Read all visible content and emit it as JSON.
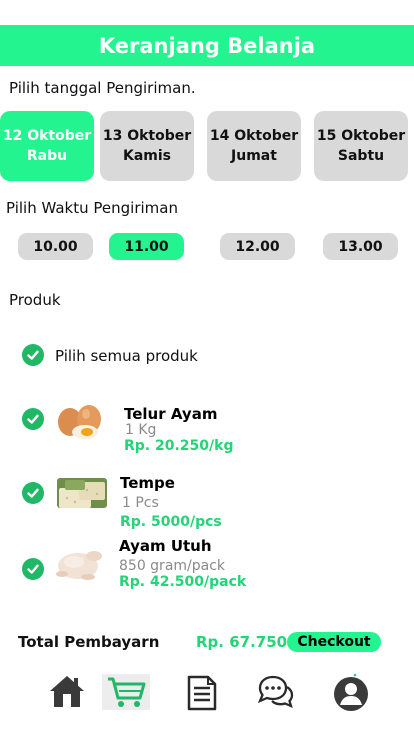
{
  "header": {
    "title": "Keranjang Belanja"
  },
  "delivery_date": {
    "label": "Pilih tanggal Pengiriman.",
    "options": [
      {
        "date": "12 Oktober",
        "day": "Rabu",
        "selected": true
      },
      {
        "date": "13 Oktober",
        "day": "Kamis",
        "selected": false
      },
      {
        "date": "14 Oktober",
        "day": "Jumat",
        "selected": false
      },
      {
        "date": "15 Oktober",
        "day": "Sabtu",
        "selected": false
      }
    ]
  },
  "delivery_time": {
    "label": "Pilih Waktu Pengiriman",
    "options": [
      "10.00",
      "11.00",
      "12.00",
      "13.00"
    ],
    "selected": "11.00"
  },
  "products": {
    "label": "Produk",
    "select_all_label": "Pilih semua produk",
    "items": [
      {
        "name": "Telur Ayam",
        "qty": "1 Kg",
        "price": "Rp. 20.250/kg",
        "icon": "eggs-icon"
      },
      {
        "name": "Tempe",
        "qty": "1 Pcs",
        "price": "Rp. 5000/pcs",
        "icon": "tempe-icon"
      },
      {
        "name": "Ayam Utuh",
        "qty": "850 gram/pack",
        "price": "Rp. 42.500/pack",
        "icon": "chicken-icon"
      }
    ]
  },
  "footer": {
    "total_label": "Total Pembayarn",
    "total_value": "Rp. 67.750",
    "checkout_label": "Checkout"
  },
  "bottom_nav": {
    "items": [
      "home-icon",
      "cart-icon",
      "document-icon",
      "chat-icon",
      "profile-icon"
    ],
    "active": "cart-icon"
  },
  "colors": {
    "accent": "#24f48f",
    "price": "#24d477",
    "check": "#1fb866",
    "inactive": "#d9d9d9"
  }
}
